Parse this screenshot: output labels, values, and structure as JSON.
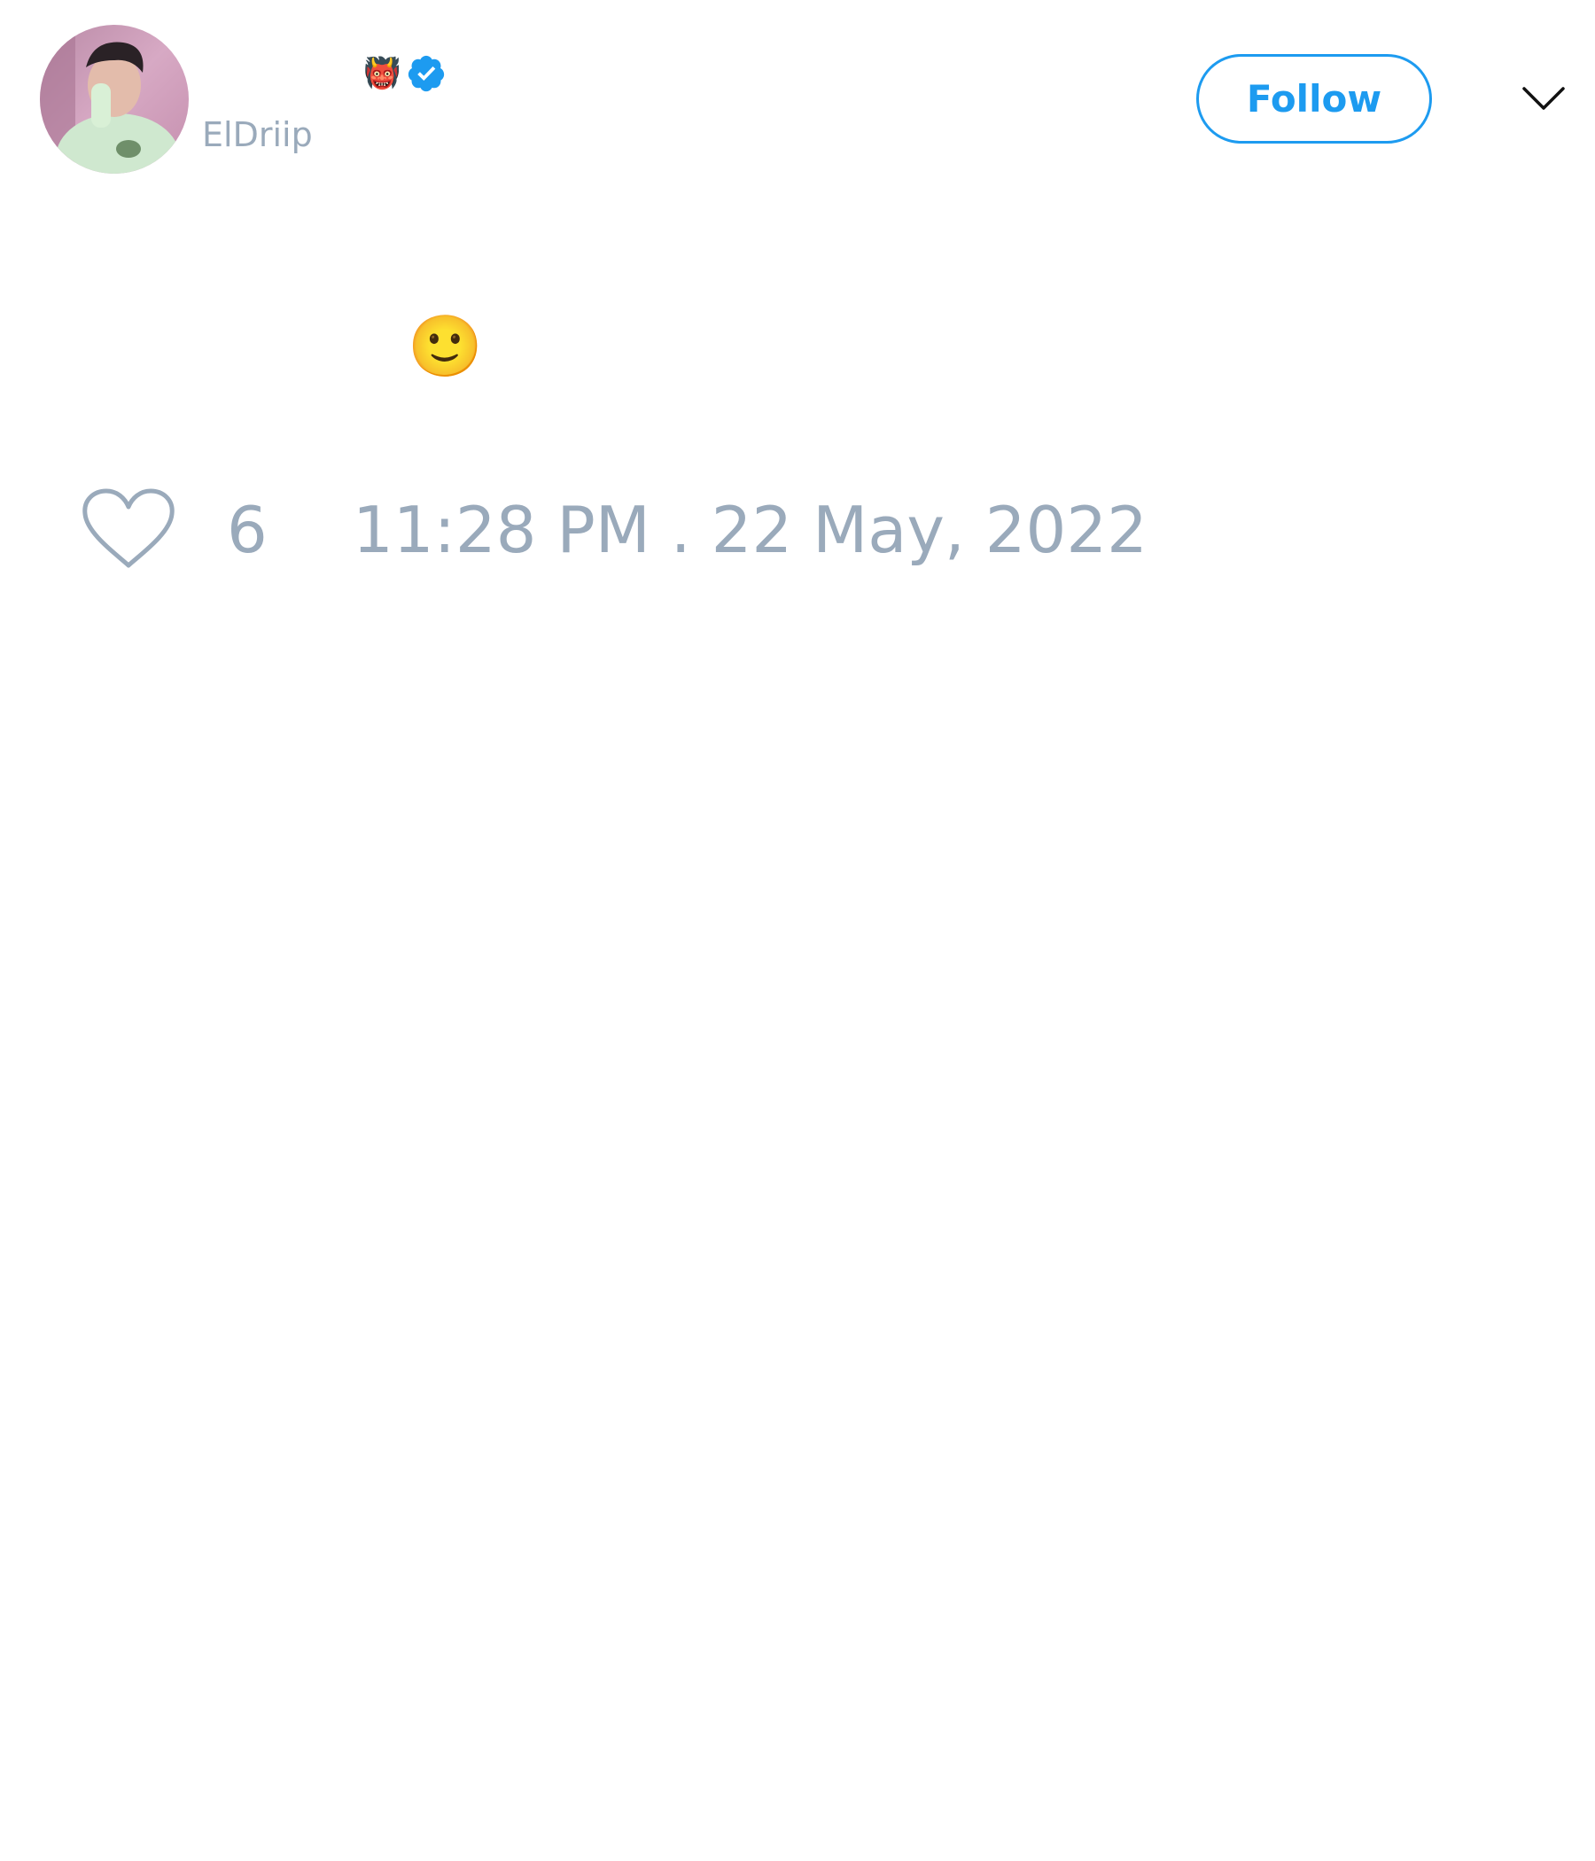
{
  "user": {
    "name_emoji": "👹",
    "handle": "ElDriip",
    "verified": true,
    "verified_color": "#1d9bf0"
  },
  "actions": {
    "follow_label": "Follow",
    "more_icon": "chevron-down-icon"
  },
  "tweet": {
    "text": "🙂"
  },
  "footer": {
    "like_icon": "heart-icon",
    "like_count": "6",
    "timestamp": "11:28 PM . 22 May, 2022"
  },
  "colors": {
    "accent": "#1d9bf0",
    "muted_text": "#9aaabb"
  }
}
